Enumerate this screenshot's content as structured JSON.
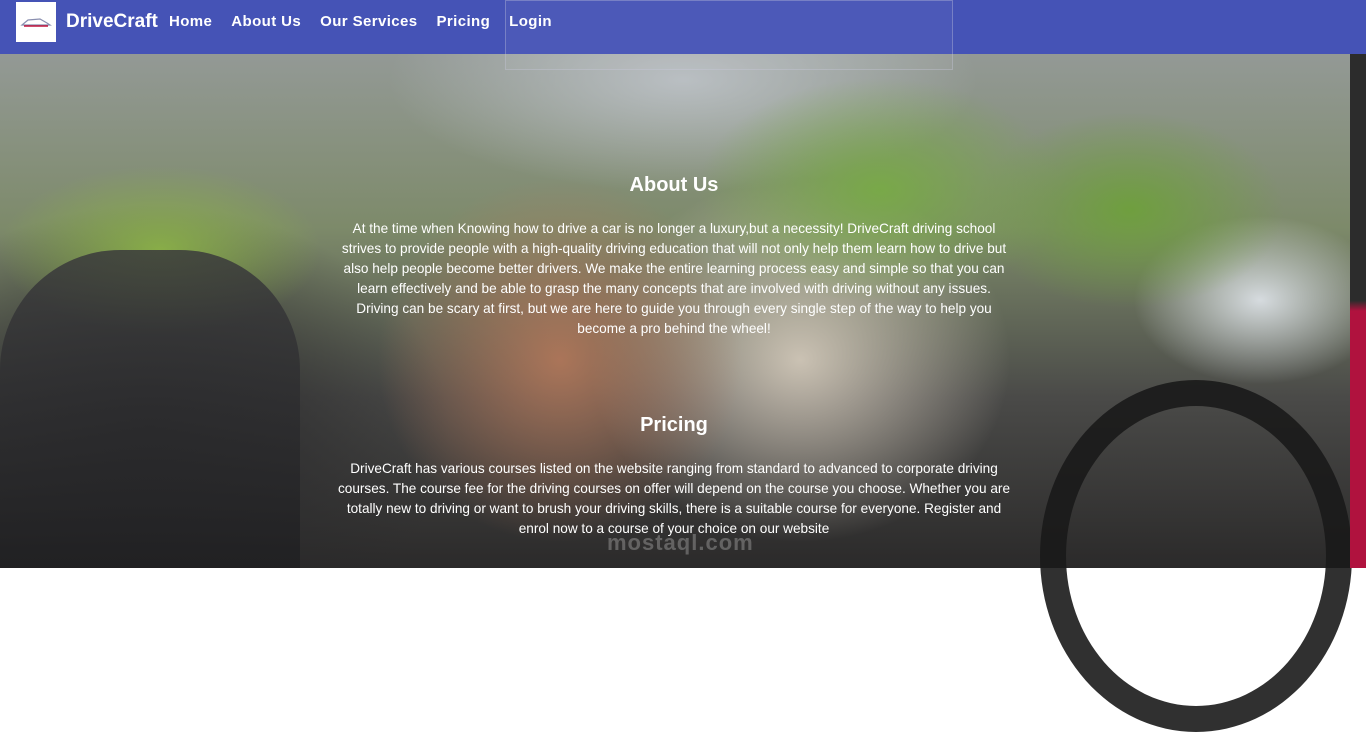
{
  "brand": {
    "name": "DriveCraft",
    "logo_icon": "car-logo-icon"
  },
  "nav": {
    "items": [
      {
        "label": "Home"
      },
      {
        "label": "About Us"
      },
      {
        "label": "Our Services"
      },
      {
        "label": "Pricing"
      },
      {
        "label": "Login"
      }
    ]
  },
  "about": {
    "title": "About Us",
    "text": "At the time when Knowing how to drive a car is no longer a luxury,but a necessity! DriveCraft driving school strives to provide people with a high-quality driving education that will not only help them learn how to drive but also help people become better drivers. We make the entire learning process easy and simple so that you can learn effectively and be able to grasp the many concepts that are involved with driving without any issues. Driving can be scary at first, but we are here to guide you through every single step of the way to help you become a pro behind the wheel!"
  },
  "pricing": {
    "title": "Pricing",
    "text": "DriveCraft has various courses listed on the website ranging from standard to advanced to corporate driving courses. The course fee for the driving courses on offer will depend on the course you choose. Whether you are totally new to driving or want to brush your driving skills, there is a suitable course for everyone. Register and enrol now to a course of your choice on our website"
  },
  "watermark": "mostaql.com",
  "colors": {
    "header": "#4553b6",
    "accent": "#b0123e"
  }
}
